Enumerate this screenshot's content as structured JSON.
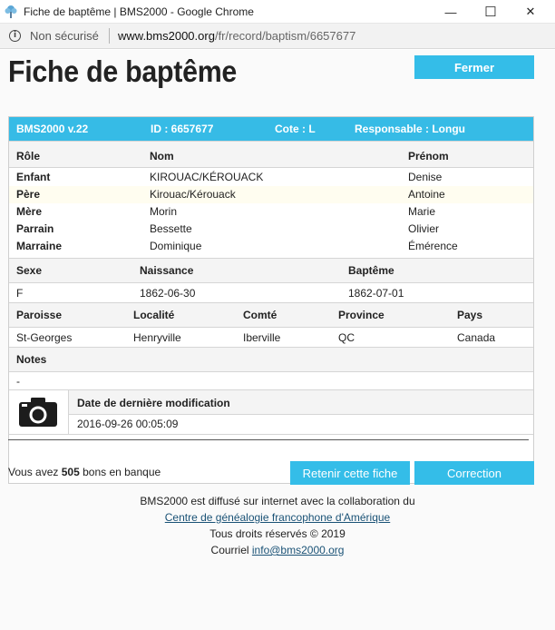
{
  "window": {
    "title": "Fiche de baptême | BMS2000 - Google Chrome",
    "minimize": "—",
    "maximize": "☐",
    "close": "✕"
  },
  "address": {
    "security": "Non sécurisé",
    "domain": "www.bms2000.org",
    "path": "/fr/record/baptism/6657677"
  },
  "page": {
    "title": "Fiche de baptême",
    "close_button": "Fermer"
  },
  "record": {
    "header": {
      "version": "BMS2000 v.22",
      "id": "ID : 6657677",
      "cote": "Cote : L",
      "responsable": "Responsable : Longu"
    },
    "persons_headers": [
      "Rôle",
      "Nom",
      "Prénom"
    ],
    "persons": [
      {
        "role": "Enfant",
        "nom": "KIROUAC/KÉROUACK",
        "prenom": "Denise"
      },
      {
        "role": "Père",
        "nom": "Kirouac/Kérouack",
        "prenom": "Antoine"
      },
      {
        "role": "Mère",
        "nom": "Morin",
        "prenom": "Marie"
      },
      {
        "role": "Parrain",
        "nom": "Bessette",
        "prenom": "Olivier"
      },
      {
        "role": "Marraine",
        "nom": "Dominique",
        "prenom": "Émérence"
      }
    ],
    "dates_headers": [
      "Sexe",
      "Naissance",
      "Baptême"
    ],
    "dates_values": [
      "F",
      "1862-06-30",
      "1862-07-01"
    ],
    "place_headers": [
      "Paroisse",
      "Localité",
      "Comté",
      "Province",
      "Pays"
    ],
    "place_values": [
      "St-Georges",
      "Henryville",
      "Iberville",
      "QC",
      "Canada"
    ],
    "notes_header": "Notes",
    "notes_value": "-",
    "modified_header": "Date de dernière modification",
    "modified_value": "2016-09-26 00:05:09",
    "camera_icon": "camera-icon"
  },
  "bank": {
    "prefix": "Vous avez",
    "count": "505",
    "suffix": "bons en banque"
  },
  "actions": {
    "retain": "Retenir cette fiche",
    "correction": "Correction"
  },
  "footer": {
    "line1": "BMS2000 est diffusé sur internet avec la collaboration du",
    "link": "Centre de généalogie francophone d'Amérique",
    "line3": "Tous droits réservés © 2019",
    "contact_label": "Courriel",
    "email": "info@bms2000.org"
  },
  "colors": {
    "accent": "#36bbe6",
    "highlight_row": "#fffdf0"
  }
}
